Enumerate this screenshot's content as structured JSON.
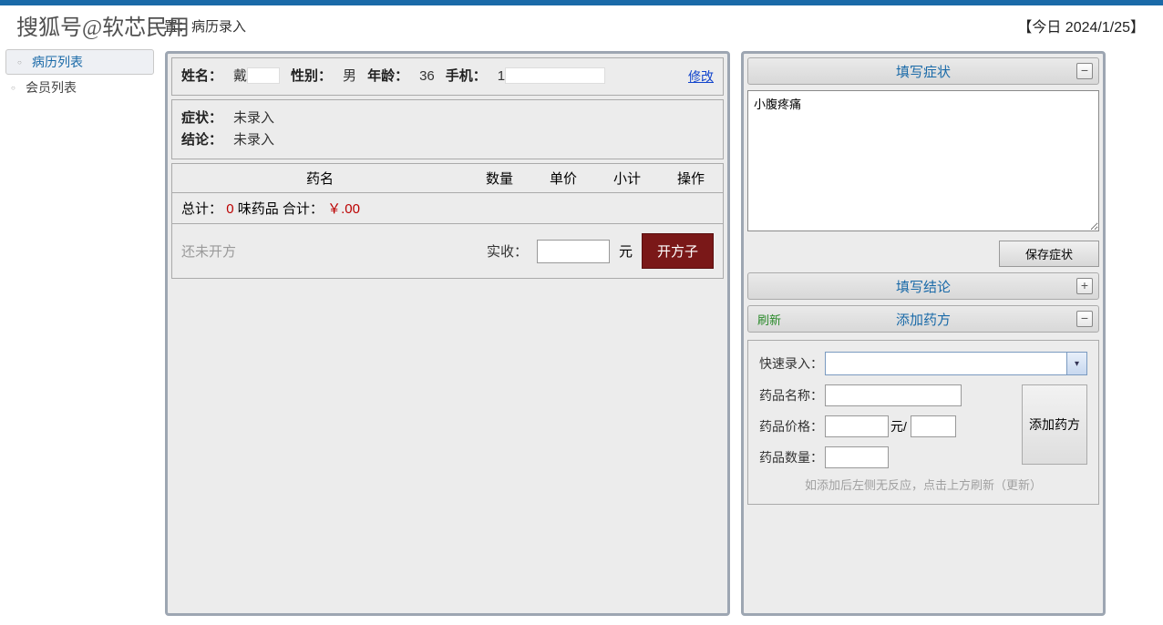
{
  "watermark": "搜狐号@软芯民用",
  "breadcrumb": {
    "label": "置：",
    "value": "病历录入"
  },
  "today": "【今日 2024/1/25】",
  "sidebar": {
    "items": [
      {
        "label": "病历列表",
        "active": true
      },
      {
        "label": "会员列表",
        "active": false
      }
    ]
  },
  "patient": {
    "name_label": "姓名：",
    "name_value": "戴",
    "gender_label": "性别：",
    "gender_value": "男",
    "age_label": "年龄：",
    "age_value": "36",
    "phone_label": "手机：",
    "phone_prefix": "1",
    "modify": "修改",
    "symptom_label": "症状：",
    "symptom_value": "未录入",
    "conclusion_label": "结论：",
    "conclusion_value": "未录入"
  },
  "rx_table": {
    "headers": {
      "name": "药名",
      "qty": "数量",
      "price": "单价",
      "sub": "小计",
      "op": "操作"
    },
    "summary_prefix": "总计：",
    "summary_count": "0",
    "summary_unit": "味药品",
    "summary_total_label": "合计：",
    "summary_amount": "￥.00",
    "empty": "还未开方",
    "received_label": "实收：",
    "received_unit": "元",
    "open_rx_btn": "开方子"
  },
  "symptoms": {
    "title": "填写症状",
    "text": "小腹疼痛",
    "save_btn": "保存症状"
  },
  "conclusion_section": {
    "title": "填写结论"
  },
  "rx_form": {
    "refresh": "刷新",
    "title": "添加药方",
    "quick_label": "快速录入：",
    "name_label": "药品名称：",
    "price_label": "药品价格：",
    "price_unit": "元/",
    "qty_label": "药品数量：",
    "add_btn": "添加药方",
    "hint": "如添加后左侧无反应，点击上方刷新（更新）"
  }
}
